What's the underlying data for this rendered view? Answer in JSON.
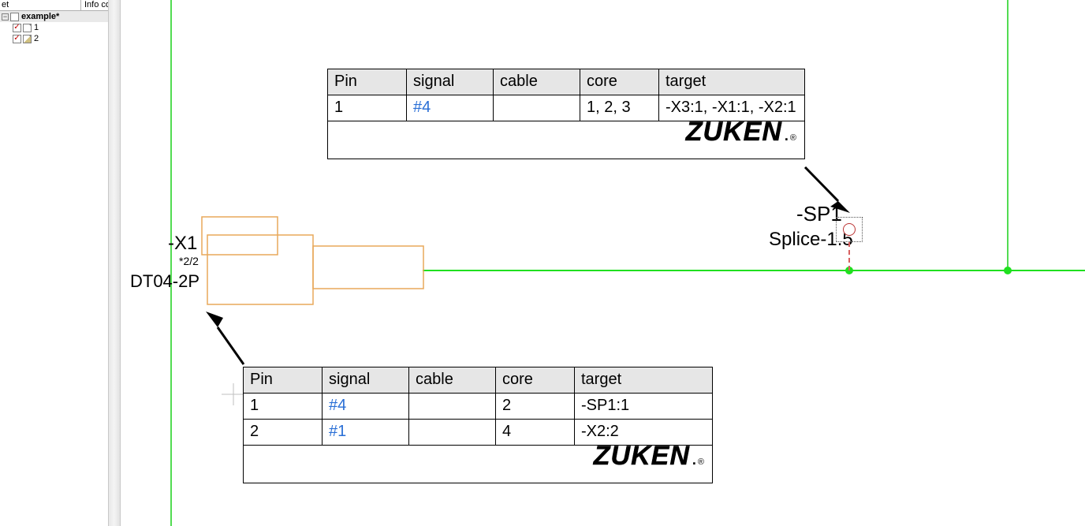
{
  "sidebar": {
    "header_col_a": "et",
    "header_col_b": "Info colu",
    "project_name": "example*",
    "pages": [
      {
        "label": "1"
      },
      {
        "label": "2"
      }
    ]
  },
  "connector": {
    "designator": "-X1",
    "slot": "*2/2",
    "part_number": "DT04-2P"
  },
  "splice": {
    "designator": "-SP1",
    "type": "Splice-1.5"
  },
  "brand": {
    "name": "ZUKEN",
    "dot": ".",
    "reg": "®"
  },
  "table_columns": [
    "Pin",
    "signal",
    "cable",
    "core",
    "target"
  ],
  "table_top": {
    "rows": [
      {
        "pin": "1",
        "signal": "#4",
        "cable": "",
        "core": "1, 2, 3",
        "target": "-X3:1, -X1:1, -X2:1"
      }
    ]
  },
  "table_bottom": {
    "rows": [
      {
        "pin": "1",
        "signal": "#4",
        "cable": "",
        "core": "2",
        "target": "-SP1:1"
      },
      {
        "pin": "2",
        "signal": "#1",
        "cable": "",
        "core": "4",
        "target": "-X2:2"
      }
    ]
  },
  "colors": {
    "wire_green": "#1fe01f",
    "connector_orange": "#e8a85a",
    "sheet_green": "#18d018"
  }
}
